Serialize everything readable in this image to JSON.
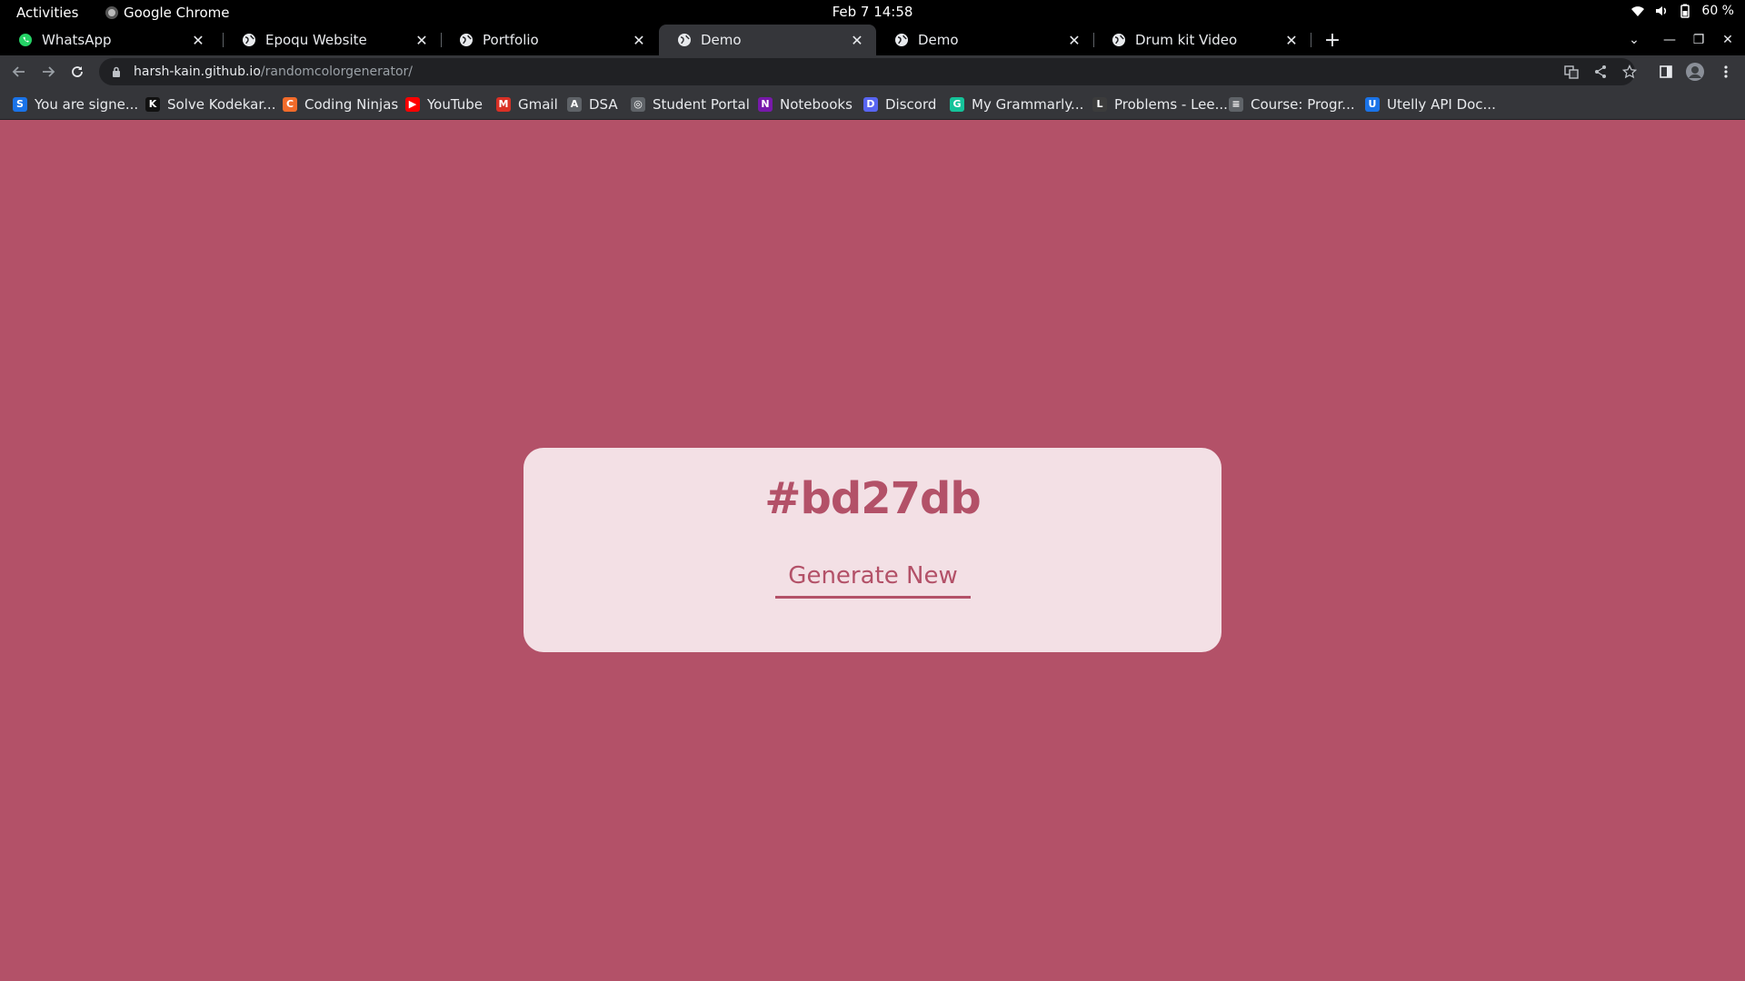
{
  "system_bar": {
    "activities": "Activities",
    "app_name": "Google Chrome",
    "clock": "Feb 7  14:58",
    "battery": "60 %"
  },
  "tabs": [
    {
      "label": "WhatsApp",
      "icon": "whatsapp-icon",
      "active": false
    },
    {
      "label": "Epoqu Website",
      "icon": "globe-icon",
      "active": false
    },
    {
      "label": "Portfolio",
      "icon": "globe-icon",
      "active": false
    },
    {
      "label": "Demo",
      "icon": "globe-icon",
      "active": true
    },
    {
      "label": "Demo",
      "icon": "globe-icon",
      "active": false
    },
    {
      "label": "Drum kit Video",
      "icon": "globe-icon",
      "active": false
    }
  ],
  "omnibox": {
    "host": "harsh-kain.github.io",
    "path": "/randomcolorgenerator/"
  },
  "bookmarks": [
    {
      "label": "You are signe...",
      "icon_char": "S",
      "color": "#1a73e8"
    },
    {
      "label": "Solve Kodekar...",
      "icon_char": "K",
      "color": "#111111"
    },
    {
      "label": "Coding Ninjas",
      "icon_char": "C",
      "color": "#f26b2a"
    },
    {
      "label": "YouTube",
      "icon_char": "▶",
      "color": "#ff0000"
    },
    {
      "label": "Gmail",
      "icon_char": "M",
      "color": "#d93025"
    },
    {
      "label": "DSA",
      "icon_char": "A",
      "color": "#5f6368"
    },
    {
      "label": "Student Portal",
      "icon_char": "◎",
      "color": "#5f6368"
    },
    {
      "label": "Notebooks",
      "icon_char": "N",
      "color": "#7719aa"
    },
    {
      "label": "Discord",
      "icon_char": "D",
      "color": "#5865f2"
    },
    {
      "label": "My Grammarly...",
      "icon_char": "G",
      "color": "#15c39a"
    },
    {
      "label": "Problems - Lee...",
      "icon_char": "L",
      "color": "#3c3c3c"
    },
    {
      "label": "Course: Progr...",
      "icon_char": "≡",
      "color": "#5f6368"
    },
    {
      "label": "Utelly API Doc...",
      "icon_char": "U",
      "color": "#1a73e8"
    }
  ],
  "page": {
    "background_color": "#b35168",
    "hex_value": "#bd27db",
    "generate_label": "Generate New"
  }
}
